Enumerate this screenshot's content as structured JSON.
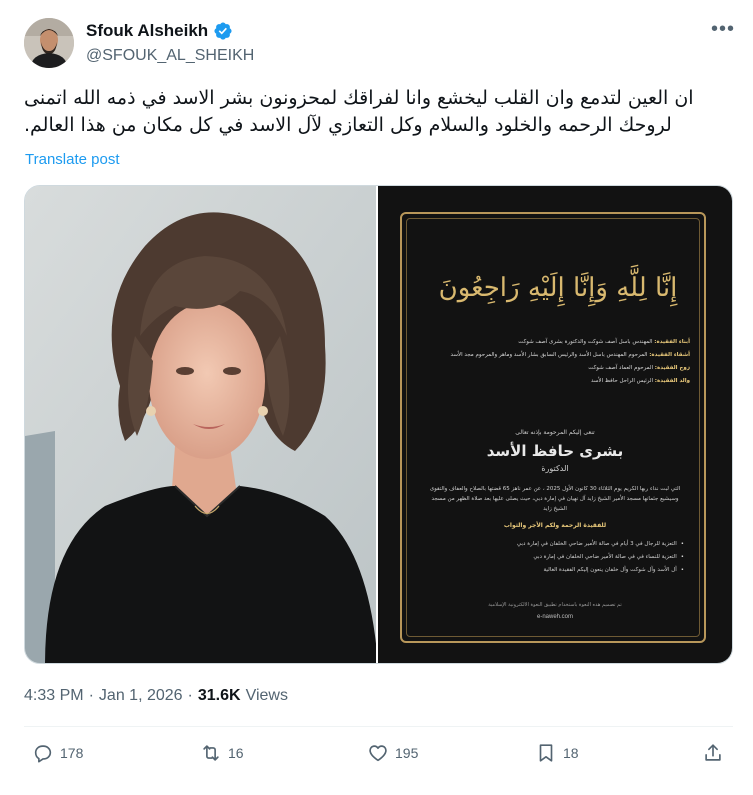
{
  "author": {
    "display_name": "Sfouk Alsheikh",
    "handle": "@SFOUK_AL_SHEIKH",
    "verified_color": "#1d9bf0",
    "icons": {
      "avatar": "avatar",
      "verified": "verified-badge-icon",
      "more": "more-options-icon"
    }
  },
  "post": {
    "text": "ان العين لتدمع وان القلب ليخشع وانا لفراقك لمحزونون بشر الاسد في ذمه الله اتمنى لروحك الرحمه والخلود والسلام وكل التعازي لآل الاسد في كل مكان من هذا العالم.",
    "translate_label": "Translate post"
  },
  "card": {
    "calligraphy": "إِنَّا لِلَّهِ وَإِنَّا إِلَيْهِ رَاجِعُونَ",
    "family_lines": [
      {
        "label": "أبناء الفقيدة:",
        "text": "المهندس باسل آصف شوكت والدكتورة بشرى آصف شوكت"
      },
      {
        "label": "أشقاء الفقيدة:",
        "text": "المرحوم المهندس باسل الأسد والرئيس السابق بشار الأسد وماهر والمرحوم مجد الأسد"
      },
      {
        "label": "زوج الفقيدة:",
        "text": "المرحوم العماد آصف شوكت"
      },
      {
        "label": "والد الفقيدة:",
        "text": "الرئيس الراحل حافظ الأسد"
      }
    ],
    "intro": "تنعى إليكم المرحومة بإذنه تعالى",
    "name": "بشرى حافظ الأسد",
    "title": "الدكتورة",
    "body": "التي لبت نداء ربها الكريم يوم الثلاثاء 30 كانون الأول 2025 ، عن عمر ناهز 65 قضتها بالصلاح والعفاف والتقوى وسيشيع جثمانها مسجد الأمير الشيخ زايد آل نهيان في إمارة دبي، حيث يصلى عليها بعد صلاة الظهر من مسجد الشيخ زايد",
    "prayer": "للفقيدة الرحمة ولكم الأجر والثواب",
    "condolences": [
      "التعزية للرجال في 3 أيام في صالة الأمير ضاحي الخلفان في إمارة دبي",
      "التعزية للنساء في في صالة الأمير ضاحي الخلفان في إمارة دبي",
      "آل الأسد وآل شوكت وآل خلفان ينعون إليكم الفقيدة الغالية"
    ],
    "footer": "تم تصميم هذه النعوة باستخدام تطبيق النعوة الالكترونية الإسلامية",
    "url": "e-naweh.com"
  },
  "meta": {
    "time": "4:33 PM",
    "separator": "·",
    "date": "Jan 1, 2026",
    "views_count": "31.6K",
    "views_label": "Views"
  },
  "actions": {
    "replies": "178",
    "reposts": "16",
    "likes": "195",
    "bookmarks": "18",
    "icons": [
      "reply-icon",
      "repost-icon",
      "like-icon",
      "bookmark-icon",
      "share-icon"
    ]
  },
  "colors": {
    "text_primary": "#0f1419",
    "text_secondary": "#536471",
    "link": "#1d9bf0",
    "border": "#cfd9de",
    "gold": "#b8975a"
  }
}
